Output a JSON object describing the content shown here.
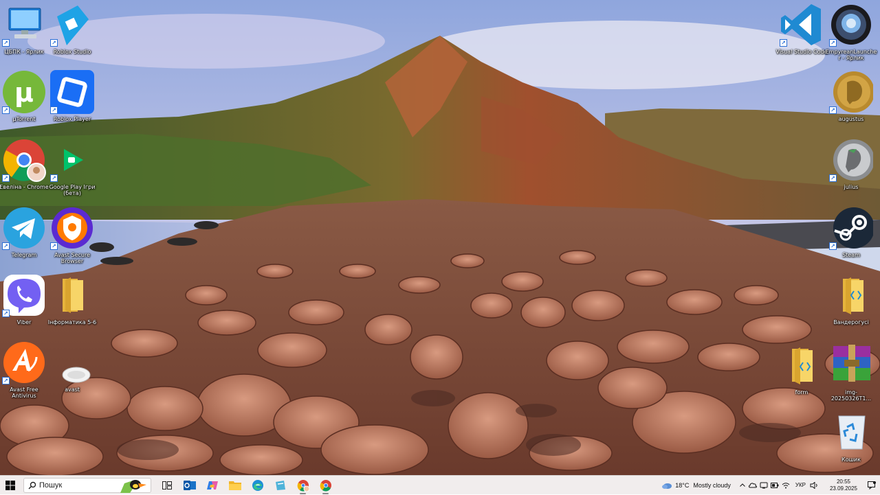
{
  "desktop": {
    "icons_left": [
      {
        "label": "ЦБПК - Ярлик",
        "icon": "computer-icon"
      },
      {
        "label": "Roblox Studio",
        "icon": "roblox-studio-icon"
      },
      {
        "label": "µTorrent",
        "icon": "utorrent-icon"
      },
      {
        "label": "Roblox Player",
        "icon": "roblox-player-icon"
      },
      {
        "label": "Евеліна - Chrome",
        "icon": "chrome-profile-icon"
      },
      {
        "label": "Google Play Ігри (бета)",
        "icon": "google-play-games-icon"
      },
      {
        "label": "Telegram",
        "icon": "telegram-icon"
      },
      {
        "label": "Avast Secure Browser",
        "icon": "avast-secure-browser-icon"
      },
      {
        "label": "Viber",
        "icon": "viber-icon"
      },
      {
        "label": "Інформатика 5-6",
        "icon": "folder-icon"
      },
      {
        "label": "Avast Free Antivirus",
        "icon": "avast-antivirus-icon"
      },
      {
        "label": "avast",
        "icon": "avast-file-icon"
      }
    ],
    "icons_right": [
      {
        "label": "Visual Studio Code",
        "icon": "vscode-icon"
      },
      {
        "label": "EmpyreanLauncher - Ярлик",
        "icon": "empyrean-launcher-icon"
      },
      {
        "label": "augustus",
        "icon": "augustus-coin-icon"
      },
      {
        "label": "julius",
        "icon": "julius-coin-icon"
      },
      {
        "label": "Steam",
        "icon": "steam-icon"
      },
      {
        "label": "Вандерогусі",
        "icon": "code-folder-icon"
      },
      {
        "label": "form",
        "icon": "code-folder-icon"
      },
      {
        "label": "img-20250326T1...",
        "icon": "winrar-archive-icon"
      },
      {
        "label": "Кошик",
        "icon": "recycle-bin-icon"
      }
    ]
  },
  "taskbar": {
    "search_placeholder": "Пошук",
    "apps": [
      "task-view-icon",
      "outlook-icon",
      "copilot-icon",
      "file-explorer-icon",
      "edge-icon",
      "onedrive-app-icon",
      "chrome-profile-icon",
      "chrome-icon"
    ],
    "weather": {
      "temp": "18°C",
      "condition": "Mostly cloudy"
    },
    "language": "УКР",
    "time": "20:55",
    "date": "23.09.2025"
  },
  "colors": {
    "taskbar_bg": "#f1eded",
    "accent": "#0078d4"
  }
}
